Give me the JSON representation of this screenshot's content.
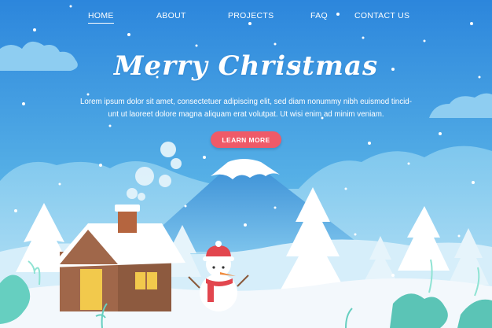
{
  "nav": {
    "items": [
      {
        "label": "HOME",
        "active": true
      },
      {
        "label": "ABOUT",
        "active": false
      },
      {
        "label": "PROJECTS",
        "active": false
      },
      {
        "label": "FAQ",
        "active": false
      },
      {
        "label": "CONTACT US",
        "active": false
      }
    ]
  },
  "hero": {
    "title": "Merry Christmas",
    "text_line1": "Lorem ipsum dolor sit amet, consectetuer adipiscing elit, sed diam nonummy nibh euismod tincid-",
    "text_line2": "unt ut laoreet dolore magna aliquam erat volutpat. Ut wisi enim ad minim veniam.",
    "cta_label": "LEARN MORE"
  },
  "colors": {
    "sky_top": "#2c86dc",
    "sky_bottom": "#9ad6f0",
    "snow": "#f3f8fc",
    "cta": "#ef5a68",
    "house_wall": "#a0674a",
    "door": "#f2c94c",
    "chimney": "#b5653f",
    "scarf": "#e2464e",
    "foliage": "#66cfc0"
  },
  "icons": [
    "snowman-icon",
    "house-icon",
    "mountain-icon",
    "tree-icon",
    "snowflake-icon",
    "cloud-icon",
    "chimney-smoke-icon",
    "plant-icon"
  ]
}
